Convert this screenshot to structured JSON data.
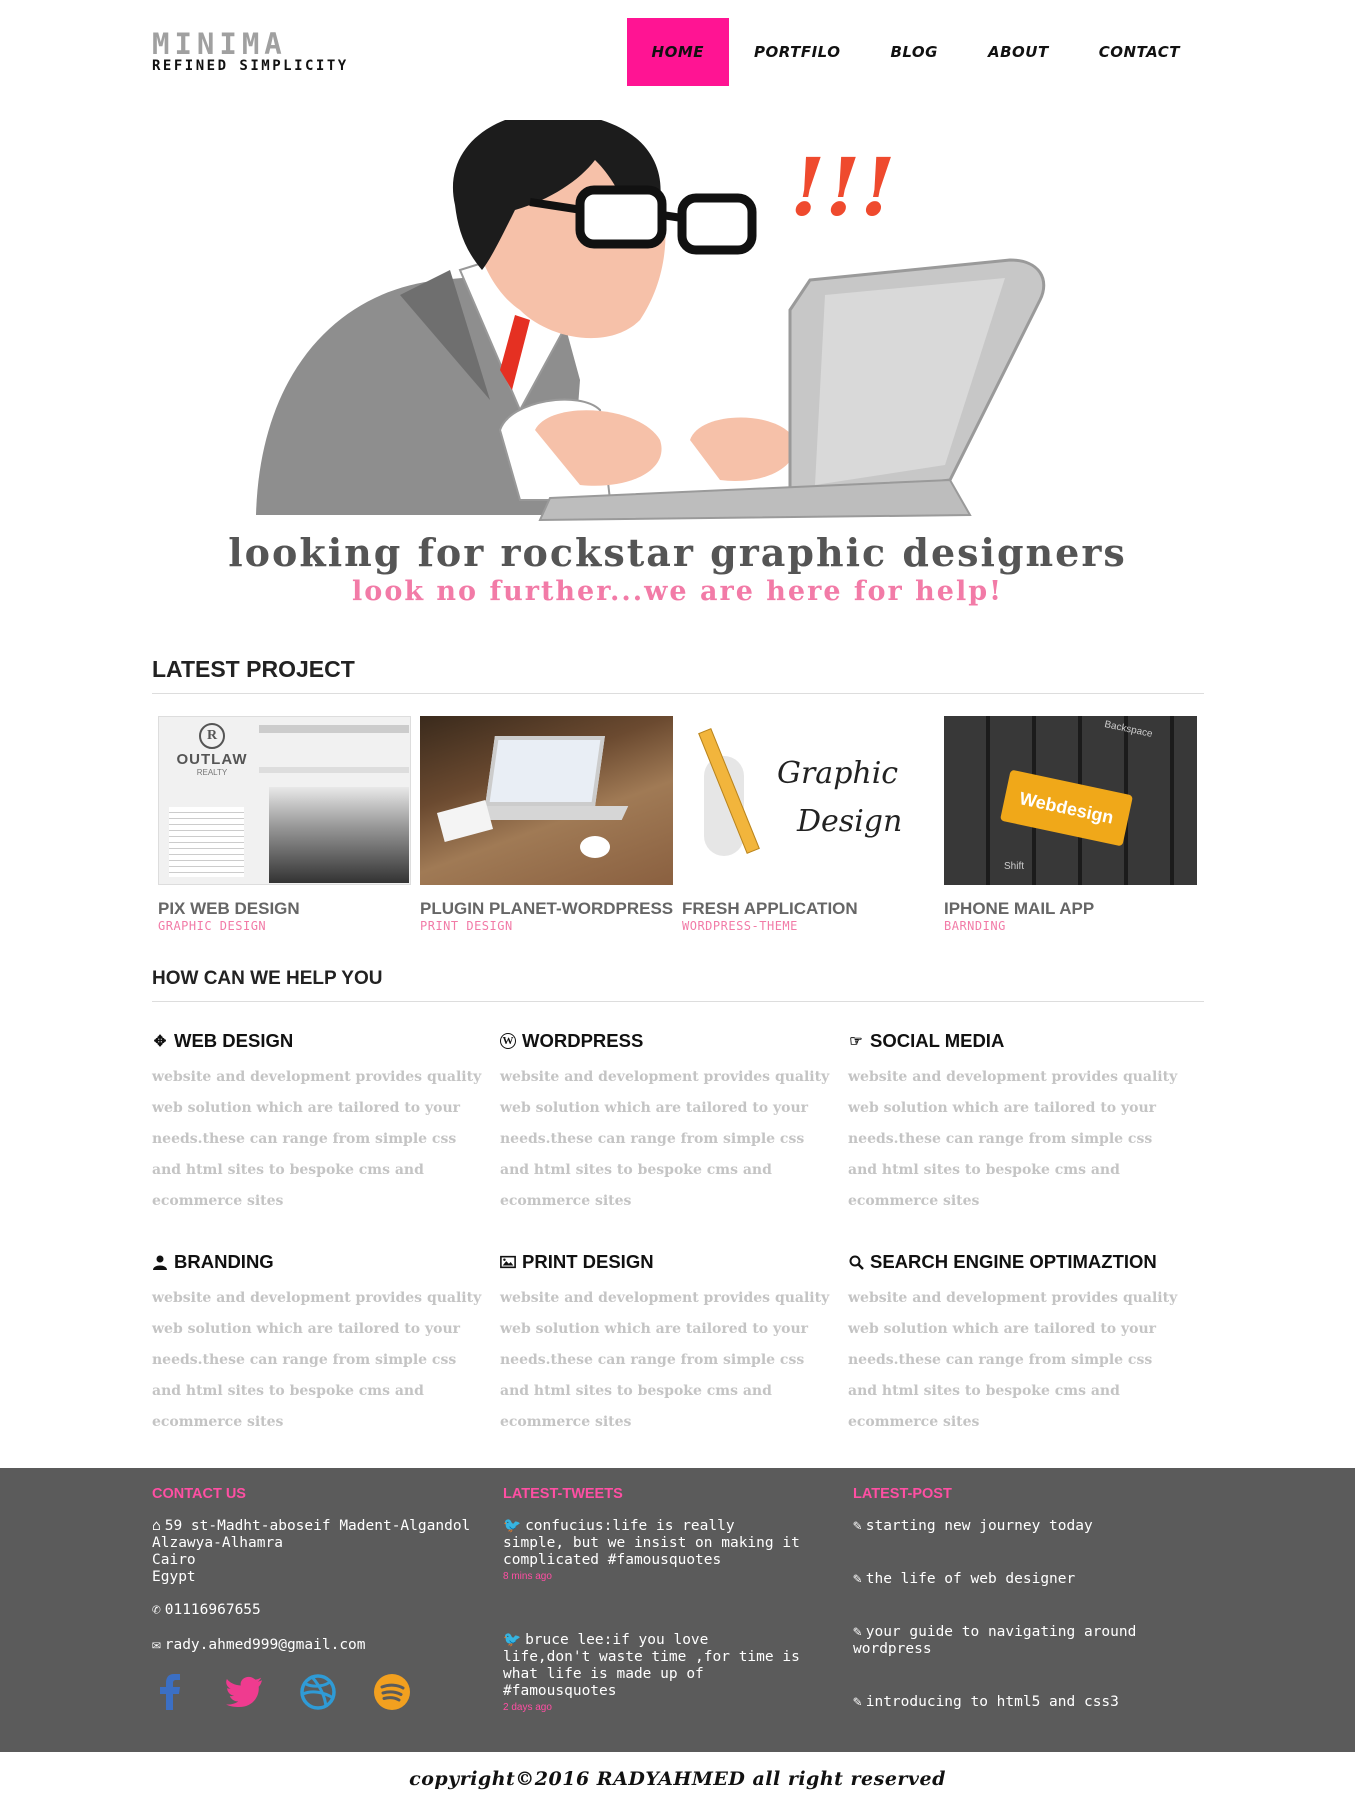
{
  "logo": {
    "title": "MINIMA",
    "subtitle": "REFINED SIMPLICITY"
  },
  "nav": {
    "items": [
      "HOME",
      "PORTFILO",
      "BLOG",
      "ABOUT",
      "CONTACT"
    ],
    "active": "HOME",
    "accent": "#ff1493"
  },
  "hero": {
    "title": "looking for rockstar graphic designers",
    "subtitle": "look no further...we are here for help!",
    "exclaim": "!!!"
  },
  "latest": {
    "heading": "LATEST PROJECT",
    "projects": [
      {
        "name": "PIX WEB DESIGN",
        "category": "GRAPHIC DESIGN",
        "thumb_brand": "OUTLAW",
        "thumb_brand_sub": "REALTY"
      },
      {
        "name": "PLUGIN PLANET-WORDPRESS",
        "category": "PRINT DESIGN"
      },
      {
        "name": "FRESH APPLICATION",
        "category": "WORDPRESS-THEME",
        "thumb_line1": "Graphic",
        "thumb_line2": "Design"
      },
      {
        "name": "IPHONE MAIL APP",
        "category": "BARNDING",
        "thumb_key": "Webdesign",
        "thumb_backspace": "Backspace",
        "thumb_shift": "Shift"
      }
    ]
  },
  "help": {
    "heading": "HOW CAN WE HELP YOU",
    "services": [
      {
        "title": "WEB DESIGN",
        "icon": "arrows-icon",
        "text": "website and development provides quality web solution which are tailored to your needs.these can range from simple css and html sites to bespoke cms and ecommerce sites"
      },
      {
        "title": "WORDPRESS",
        "icon": "wordpress-icon",
        "text": "website and development provides quality web solution which are tailored to your needs.these can range from simple css and html sites to bespoke cms and ecommerce sites"
      },
      {
        "title": "SOCIAL MEDIA",
        "icon": "thumbs-up-icon",
        "text": "website and development provides quality web solution which are tailored to your needs.these can range from simple css and html sites to bespoke cms and ecommerce sites"
      },
      {
        "title": "BRANDING",
        "icon": "user-icon",
        "text": "website and development provides quality web solution which are tailored to your needs.these can range from simple css and html sites to bespoke cms and ecommerce sites"
      },
      {
        "title": "PRINT DESIGN",
        "icon": "image-icon",
        "text": "website and development provides quality web solution which are tailored to your needs.these can range from simple css and html sites to bespoke cms and ecommerce sites"
      },
      {
        "title": "SEARCH ENGINE OPTIMAZTION",
        "icon": "search-icon",
        "text": "website and development provides quality web solution which are tailored to your needs.these can range from simple css and html sites to bespoke cms and ecommerce sites"
      }
    ]
  },
  "footer": {
    "contact": {
      "heading": "CONTACT US",
      "address_lines": [
        "59 st-Madht-aboseif Madent-Algandol",
        "Alzawya-Alhamra",
        "Cairo",
        "Egypt"
      ],
      "phone": "01116967655",
      "email": "rady.ahmed999@gmail.com"
    },
    "tweets": {
      "heading": "LATEST-TWEETS",
      "items": [
        {
          "text": "confucius:life is really simple, but we insist on making it complicated #famousquotes",
          "time": "8 mins ago"
        },
        {
          "text": "bruce lee:if you love life,don't waste time ,for time is what life is made up of #famousquotes",
          "time": "2 days ago"
        }
      ]
    },
    "posts": {
      "heading": "LATEST-POST",
      "items": [
        "starting new journey today",
        "the life of web designer",
        "your guide to navigating around wordpress",
        "introducing to html5 and css3"
      ]
    },
    "social": [
      "facebook-icon",
      "twitter-icon",
      "dribbble-icon",
      "spotify-icon"
    ],
    "colors": {
      "bg": "#5b5b5b",
      "accent": "#ff4fa3"
    }
  },
  "copyright": "copyright©2016 RADYAHMED all right reserved"
}
